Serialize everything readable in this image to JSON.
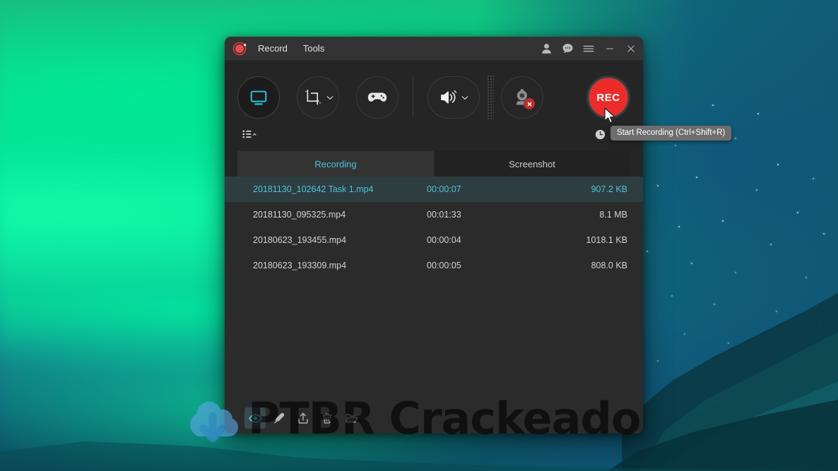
{
  "desktop": {
    "wallpaper_description": "aurora-green-night-sky-mountains",
    "accent_green": "#07e29a",
    "accent_teal": "#0e5c76"
  },
  "window": {
    "title_bar": {
      "logo_icon": "record-logo-icon",
      "menus": [
        {
          "label": "Record",
          "name": "menu-record"
        },
        {
          "label": "Tools",
          "name": "menu-tools"
        }
      ],
      "controls": [
        {
          "name": "account-icon",
          "glyph": "person"
        },
        {
          "name": "feedback-icon",
          "glyph": "speech-bubble"
        },
        {
          "name": "hamburger-menu-icon",
          "glyph": "lines"
        },
        {
          "name": "minimize-button",
          "glyph": "minus"
        },
        {
          "name": "close-button",
          "glyph": "x"
        }
      ]
    },
    "toolbar": {
      "buttons": [
        {
          "name": "fullscreen-capture-button",
          "icon": "monitor-icon",
          "state": "active",
          "color": "#2ec4e0"
        },
        {
          "name": "region-capture-button",
          "icon": "crop-icon",
          "has_dropdown": true
        },
        {
          "name": "game-capture-button",
          "icon": "gamepad-icon",
          "has_dropdown": false
        },
        {
          "name": "audio-button",
          "icon": "speaker-icon",
          "has_dropdown": true
        },
        {
          "name": "webcam-button",
          "icon": "webcam-icon",
          "badge": "disabled"
        }
      ],
      "record_button": {
        "label": "REC",
        "name": "rec-button",
        "color": "#ee2b2b"
      },
      "list_toggle": {
        "name": "list-view-toggle",
        "icon": "list-icon"
      },
      "right_icons": [
        {
          "name": "schedule-clock-icon",
          "icon": "clock-icon"
        },
        {
          "name": "task-alarm-icon",
          "icon": "alarm-clock-icon"
        }
      ]
    },
    "tabs": [
      {
        "label": "Recording",
        "name": "tab-recording",
        "active": true
      },
      {
        "label": "Screenshot",
        "name": "tab-screenshot",
        "active": false
      }
    ],
    "file_list": {
      "rows": [
        {
          "name": "20181130_102642 Task 1.mp4",
          "duration": "00:00:07",
          "size": "907.2 KB",
          "selected": true
        },
        {
          "name": "20181130_095325.mp4",
          "duration": "00:01:33",
          "size": "8.1 MB",
          "selected": false
        },
        {
          "name": "20180623_193455.mp4",
          "duration": "00:00:04",
          "size": "1018.1 KB",
          "selected": false
        },
        {
          "name": "20180623_193309.mp4",
          "duration": "00:00:05",
          "size": "808.0 KB",
          "selected": false
        }
      ]
    },
    "bottom_bar": {
      "icons": [
        {
          "name": "preview-eye-icon",
          "label": "Preview",
          "highlight": true
        },
        {
          "name": "edit-brush-icon",
          "label": "Edit",
          "highlight": false
        },
        {
          "name": "share-upload-icon",
          "label": "Share",
          "highlight": false
        },
        {
          "name": "delete-trash-icon",
          "label": "Delete",
          "highlight": false
        },
        {
          "name": "open-folder-icon",
          "label": "Open Folder",
          "highlight": false
        }
      ]
    }
  },
  "tooltip": {
    "text": "Start Recording (Ctrl+Shift+R)"
  },
  "watermark": {
    "text": "PTBR Crackeado",
    "logo_icon": "cloud-download-icon"
  }
}
